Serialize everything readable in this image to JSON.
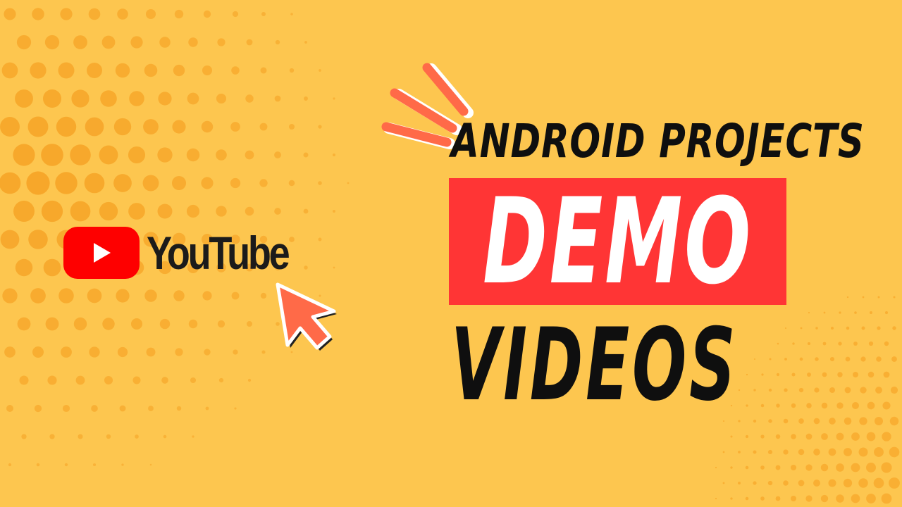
{
  "logo": {
    "wordmark": "YouTube"
  },
  "headline": {
    "line1": "ANDROID PROJECTS",
    "highlight": "DEMO",
    "line3": "VIDEOS"
  },
  "colors": {
    "background": "#fdc64f",
    "dots": "#f6a528",
    "highlight": "#ff3535",
    "youtube_red": "#fe0000",
    "cursor": "#ff6a48",
    "text": "#0f0f0f"
  },
  "icons": {
    "play": "play-triangle-icon",
    "cursor": "mouse-pointer-icon",
    "burst": "emphasis-lines-icon"
  }
}
